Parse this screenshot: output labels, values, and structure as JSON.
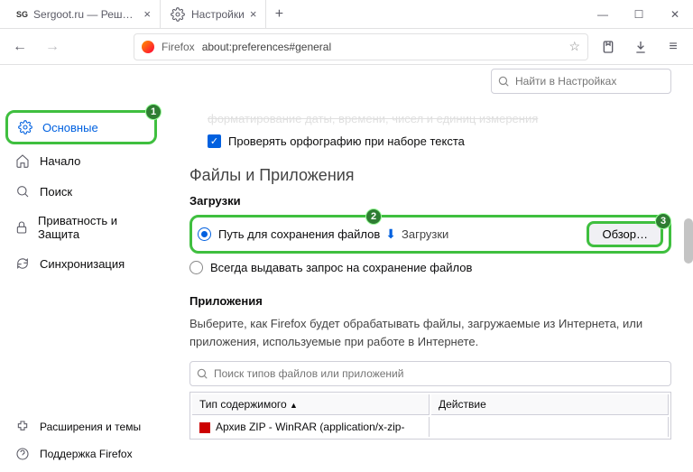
{
  "titlebar": {
    "tabs": [
      {
        "icon": "SG",
        "title": "Sergoot.ru — Решение ваши..."
      },
      {
        "icon": "gear",
        "title": "Настройки"
      }
    ]
  },
  "toolbar": {
    "identity": "Firefox",
    "url": "about:preferences#general"
  },
  "search": {
    "placeholder": "Найти в Настройках"
  },
  "sidebar": {
    "items": [
      {
        "label": "Основные"
      },
      {
        "label": "Начало"
      },
      {
        "label": "Поиск"
      },
      {
        "label": "Приватность и Защита"
      },
      {
        "label": "Синхронизация"
      }
    ],
    "footer": [
      {
        "label": "Расширения и темы"
      },
      {
        "label": "Поддержка Firefox"
      }
    ]
  },
  "main": {
    "truncated": "форматирование даты, времени, чисел и единиц измерения",
    "spellcheck": "Проверять орфографию при наборе текста",
    "files_section": "Файлы и Приложения",
    "downloads_h": "Загрузки",
    "radio_path": "Путь для сохранения файлов",
    "folder_label": "Загрузки",
    "browse": "Обзор…",
    "radio_ask": "Всегда выдавать запрос на сохранение файлов",
    "apps_h": "Приложения",
    "apps_desc": "Выберите, как Firefox будет обрабатывать файлы, загружаемые из Интернета, или приложения, используемые при работе в Интернете.",
    "filter_placeholder": "Поиск типов файлов или приложений",
    "col_type": "Тип содержимого",
    "col_action": "Действие",
    "row1_type": "Архив ZIP - WinRAR (application/x-zip-"
  },
  "badges": {
    "b1": "1",
    "b2": "2",
    "b3": "3"
  }
}
